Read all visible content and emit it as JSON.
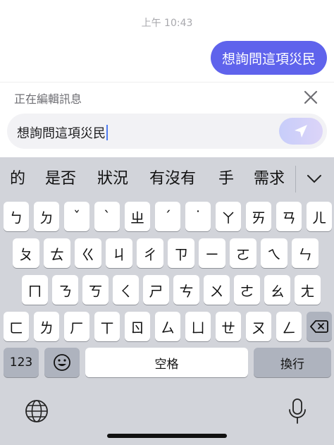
{
  "chat": {
    "timestamp": "上午 10:43",
    "sent_message": "想詢問這項災民"
  },
  "edit_bar": {
    "label": "正在編輯訊息",
    "close_icon": "close-icon"
  },
  "input": {
    "value": "想詢問這項災民",
    "send_icon": "send-icon"
  },
  "keyboard": {
    "candidates": [
      "的",
      "是否",
      "狀況",
      "有沒有",
      "手",
      "需求"
    ],
    "row1": [
      "ㄅ",
      "ㄉ",
      "ˇ",
      "ˋ",
      "ㄓ",
      "ˊ",
      "˙",
      "ㄚ",
      "ㄞ",
      "ㄢ",
      "ㄦ"
    ],
    "row2": [
      "ㄆ",
      "ㄊ",
      "ㄍ",
      "ㄐ",
      "ㄔ",
      "ㄗ",
      "ㄧ",
      "ㄛ",
      "ㄟ",
      "ㄣ"
    ],
    "row3": [
      "ㄇ",
      "ㄋ",
      "ㄎ",
      "ㄑ",
      "ㄕ",
      "ㄘ",
      "ㄨ",
      "ㄜ",
      "ㄠ",
      "ㄤ"
    ],
    "row4": [
      "ㄈ",
      "ㄌ",
      "ㄏ",
      "ㄒ",
      "ㄖ",
      "ㄙ",
      "ㄩ",
      "ㄝ",
      "ㄡ",
      "ㄥ"
    ],
    "numbers_label": "123",
    "space_label": "空格",
    "return_label": "換行",
    "icons": [
      "emoji-icon",
      "backspace-icon",
      "globe-icon",
      "microphone-icon",
      "chevron-down-icon"
    ]
  },
  "colors": {
    "bubble": "#5f63ec",
    "keyboard_bg": "#d2d4da",
    "caret": "#4f7cf0"
  }
}
